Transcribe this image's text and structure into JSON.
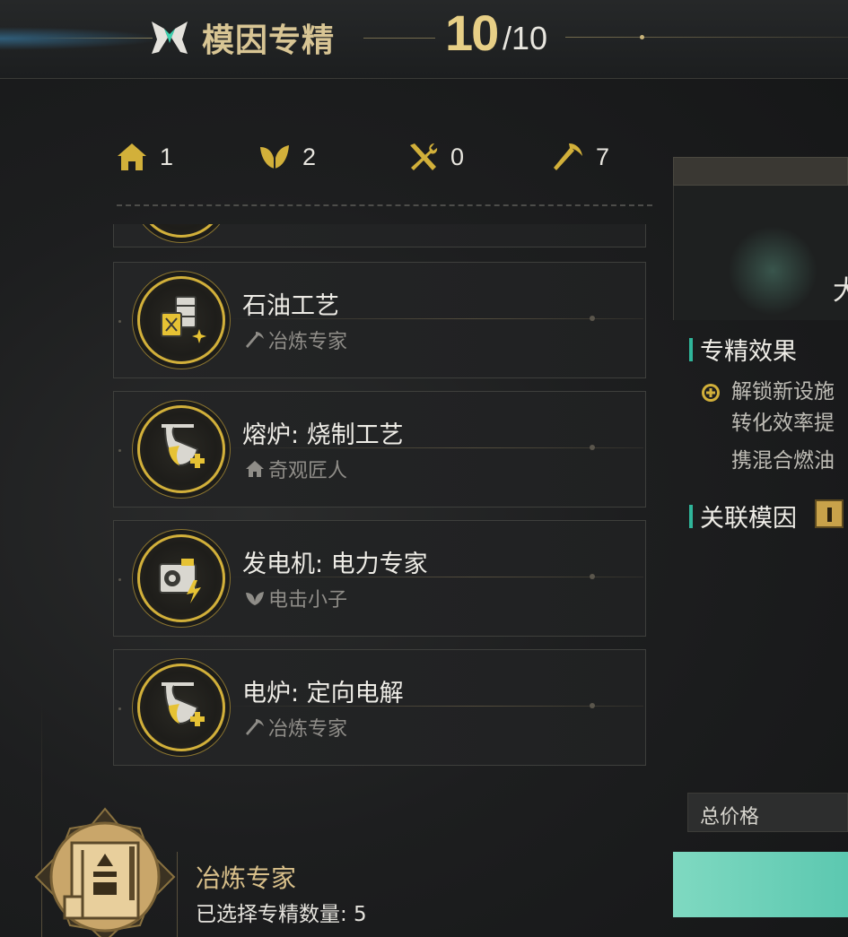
{
  "header": {
    "title": "模因专精",
    "count_current": "10",
    "count_max": "/10",
    "title_icon": "meme-crossed-icon"
  },
  "stats": [
    {
      "icon": "home-icon",
      "value": "1"
    },
    {
      "icon": "leaf-icon",
      "value": "2"
    },
    {
      "icon": "tools-icon",
      "value": "0"
    },
    {
      "icon": "pickaxe-icon",
      "value": "7"
    }
  ],
  "cards": [
    {
      "name": "石油工艺",
      "tag_icon": "pickaxe-icon",
      "tag": "冶炼专家",
      "badge_icon": "oil-barrel-icon"
    },
    {
      "name": "熔炉: 烧制工艺",
      "tag_icon": "home-icon",
      "tag": "奇观匠人",
      "badge_icon": "furnace-icon"
    },
    {
      "name": "发电机: 电力专家",
      "tag_icon": "leaf-icon",
      "tag": "电击小子",
      "badge_icon": "generator-icon"
    },
    {
      "name": "电炉: 定向电解",
      "tag_icon": "pickaxe-icon",
      "tag": "冶炼专家",
      "badge_icon": "furnace-icon"
    }
  ],
  "selection": {
    "name": "冶炼专家",
    "count_label": "已选择专精数量: 5",
    "emblem_icon": "smelter-emblem-icon"
  },
  "detail": {
    "title_partial": "大",
    "effect_heading": "专精效果",
    "effect_lines": [
      "解锁新设施",
      "转化效率提",
      "携混合燃油"
    ],
    "related_heading": "关联模因",
    "total_label": "总价格"
  },
  "colors": {
    "gold": "#d2b03a",
    "accent_teal": "#2fb59a",
    "confirm_button": "#7fd9c1"
  }
}
